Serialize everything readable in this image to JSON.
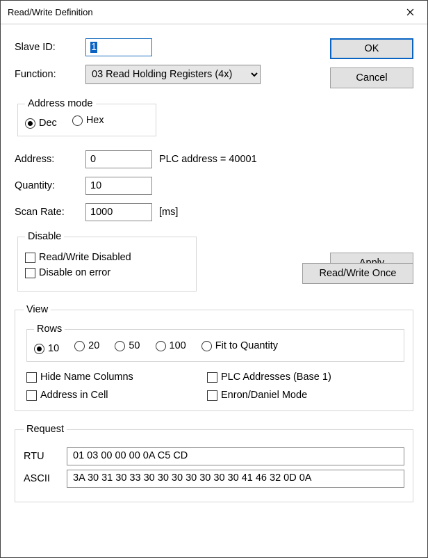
{
  "window": {
    "title": "Read/Write Definition"
  },
  "labels": {
    "slave_id": "Slave ID:",
    "function": "Function:",
    "address_mode": "Address mode",
    "dec": "Dec",
    "hex": "Hex",
    "address": "Address:",
    "plc_addr": "PLC address = 40001",
    "quantity": "Quantity:",
    "scan_rate": "Scan Rate:",
    "ms": "[ms]",
    "disable": "Disable",
    "rw_disabled": "Read/Write Disabled",
    "disable_on_error": "Disable on error",
    "view": "View",
    "rows": "Rows",
    "r10": "10",
    "r20": "20",
    "r50": "50",
    "r100": "100",
    "rfit": "Fit to Quantity",
    "hide_name": "Hide Name Columns",
    "plc_base1": "PLC Addresses (Base 1)",
    "addr_in_cell": "Address in Cell",
    "enron": "Enron/Daniel Mode",
    "request": "Request",
    "rtu": "RTU",
    "ascii": "ASCII"
  },
  "values": {
    "slave_id": "1",
    "function": "03 Read Holding Registers (4x)",
    "address": "0",
    "quantity": "10",
    "scan_rate": "1000",
    "rtu": "01 03 00 00 00 0A C5 CD",
    "ascii": "3A 30 31 30 33 30 30 30 30 30 30 30 41 46 32 0D 0A"
  },
  "buttons": {
    "ok": "OK",
    "cancel": "Cancel",
    "apply": "Apply",
    "rw_once": "Read/Write Once"
  }
}
